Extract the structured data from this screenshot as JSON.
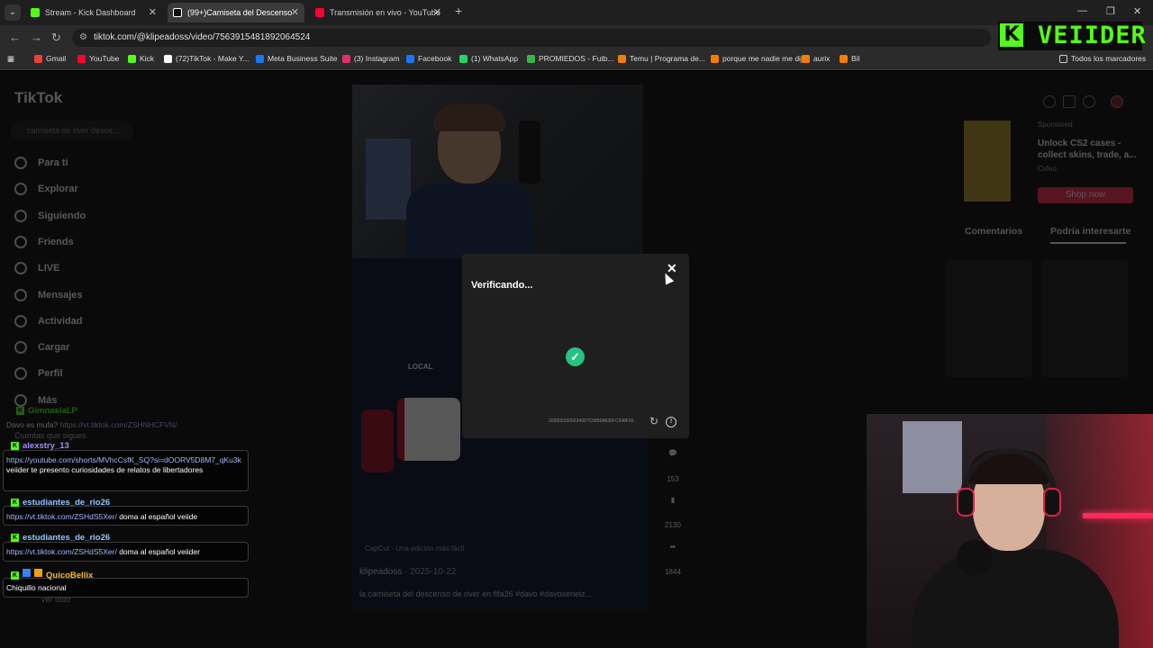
{
  "browser": {
    "tabs": [
      {
        "title": "Stream - Kick Dashboard",
        "color": "#53fc18"
      },
      {
        "title": "(99+)Camiseta del Descenso",
        "color": "#ffffff"
      },
      {
        "title": "Transmisión en vivo - YouTube",
        "color": "#ff0033"
      }
    ],
    "url": "tiktok.com/@klipeadoss/video/7563915481892064524",
    "bookmarks": [
      {
        "label": "Gmail",
        "color": "#ea4335"
      },
      {
        "label": "YouTube",
        "color": "#ff0033"
      },
      {
        "label": "Kick",
        "color": "#53fc18"
      },
      {
        "label": "(72)TikTok - Make Y...",
        "color": "#ffffff"
      },
      {
        "label": "Meta Business Suite",
        "color": "#1877f2"
      },
      {
        "label": "(3) Instagram",
        "color": "#e1306c"
      },
      {
        "label": "Facebook",
        "color": "#1877f2"
      },
      {
        "label": "(1) WhatsApp",
        "color": "#25d366"
      },
      {
        "label": "PROMIEDOS - Futb...",
        "color": "#39b54a"
      },
      {
        "label": "Temu | Programa de...",
        "color": "#f57c00"
      },
      {
        "label": "porque me nadie me dijo",
        "color": "#f57c00"
      },
      {
        "label": "aurix",
        "color": "#f57c00"
      },
      {
        "label": "Bil",
        "color": "#f57c00"
      }
    ],
    "all_bookmarks": "Todos los marcadores"
  },
  "overlay_logo": {
    "letter": "K",
    "name": "VEIIDER"
  },
  "tiktok": {
    "logo": "TikTok",
    "search_placeholder": "camiseta de river desce...",
    "nav": [
      "Para ti",
      "Explorar",
      "Siguiendo",
      "Friends",
      "LIVE",
      "Mensajes",
      "Actividad",
      "Cargar",
      "Perfil",
      "Más"
    ],
    "following_label": "Cuentas que sigues",
    "see_all": "Ver todo",
    "video": {
      "author": "klipeadoss",
      "date": "2025-10-22",
      "caption": "la camiseta del descenso de river en fifa26 #davo #davoxeneiz...",
      "capcut": "CapCut · Una edición más fácil",
      "local_label": "LOCAL",
      "counts": {
        "comments": "153",
        "saves": "2130",
        "shares": "1844"
      }
    },
    "ad": {
      "sponsored": "Sponsored",
      "title": "Unlock CS2 cases - collect skins, trade, a...",
      "brand": "Csfeo",
      "cta": "Shop now"
    },
    "right_tabs": [
      "Comentarios",
      "Podría interesarte"
    ]
  },
  "modal": {
    "title": "Verificando...",
    "code": "2026022509234307C5856A836FC548F66"
  },
  "chat": [
    {
      "user": "GimnasiaLP",
      "user_color": "#53fc18",
      "msg_prefix": "Davo es mufa? ",
      "link": "https://vt.tiktok.com/ZSHNHCFVN/",
      "text": ""
    },
    {
      "user": "alexstry_13",
      "user_color": "#a78bfa",
      "msg_prefix": "",
      "link": "https://youtube.com/shorts/MVhcCsfK_SQ?si=dOORV5D8M7_qKu3k",
      "text": " veiider te presento curiosidades de relatos de libertadores"
    },
    {
      "user": "estudiantes_de_rio26",
      "user_color": "#93c5fd",
      "msg_prefix": "",
      "link": "https://vt.tiktok.com/ZSHdS5Xer/",
      "text": " doma al español veiide"
    },
    {
      "user": "estudiantes_de_rio26",
      "user_color": "#93c5fd",
      "msg_prefix": "",
      "link": "https://vt.tiktok.com/ZSHdS5Xer/",
      "text": " doma al español veiider"
    },
    {
      "user": "QuicoBellix",
      "user_color": "#fbbf24",
      "msg_prefix": "",
      "link": "",
      "text": "Chiquillo nacional"
    }
  ]
}
